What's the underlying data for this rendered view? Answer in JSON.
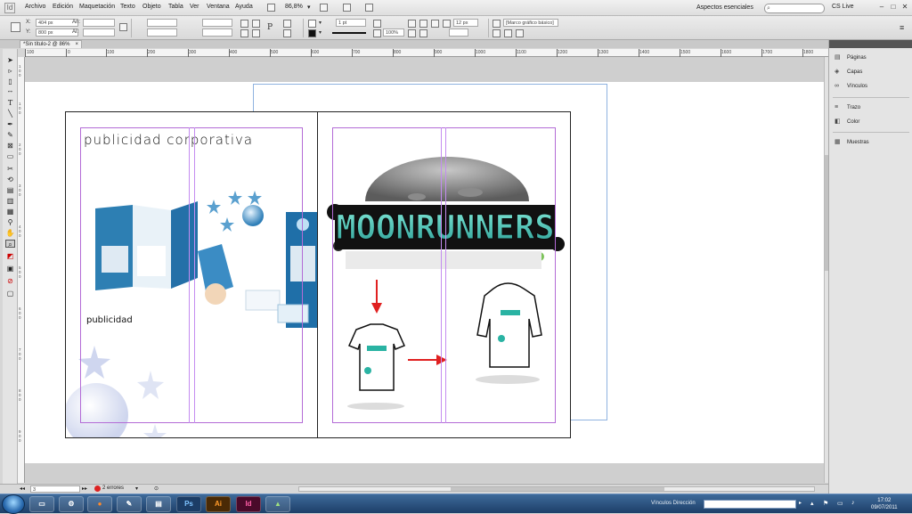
{
  "menubar": {
    "items": [
      "Archivo",
      "Edición",
      "Maquetación",
      "Texto",
      "Objeto",
      "Tabla",
      "Ver",
      "Ventana",
      "Ayuda"
    ],
    "zoom": "86,8%",
    "workspace": "Aspectos esenciales",
    "cs_live": "CS Live",
    "window_controls": [
      "–",
      "□",
      "✕"
    ]
  },
  "controlbar": {
    "x_label": "X:",
    "x_value": "404 px",
    "y_label": "Y:",
    "y_value": "800 px",
    "w_label": "An:",
    "h_label": "Al:",
    "stroke_weight": "1 pt",
    "opacity": "100%",
    "size_value": "12 px",
    "frame_style": "[Marco gráfico básico]"
  },
  "document": {
    "tab_title": "*Sin título-2 @ 86%"
  },
  "ruler": {
    "labels": [
      "100",
      "0",
      "100",
      "200",
      "300",
      "400",
      "500",
      "600",
      "700",
      "800",
      "900",
      "1000",
      "1100",
      "1200",
      "1300",
      "1400",
      "1500",
      "1600",
      "1700",
      "1800"
    ],
    "left_labels": [
      "1",
      "0",
      "0",
      "1",
      "0",
      "0",
      "2",
      "0",
      "0",
      "3",
      "0",
      "0",
      "4",
      "0",
      "0",
      "5",
      "0",
      "0",
      "6",
      "0",
      "0",
      "7",
      "0",
      "0",
      "8",
      "0",
      "0",
      "9",
      "0",
      "0"
    ]
  },
  "page_left": {
    "title": "publicidad corporativa",
    "subtitle": "publicidad"
  },
  "page_right": {
    "logo_text": "MOONRUNNERS"
  },
  "panels": {
    "items": [
      {
        "label": "Páginas",
        "icon": "pages-icon"
      },
      {
        "label": "Capas",
        "icon": "layers-icon"
      },
      {
        "label": "Vínculos",
        "icon": "links-icon"
      },
      {
        "label": "Trazo",
        "icon": "stroke-icon"
      },
      {
        "label": "Color",
        "icon": "color-icon"
      },
      {
        "label": "Muestras",
        "icon": "swatches-icon"
      }
    ]
  },
  "statusbar": {
    "page_value": "3",
    "errors": "2 errores"
  },
  "taskbar": {
    "apps": [
      "Ps",
      "Ai",
      "Id"
    ],
    "address_label": "Vínculos   Dirección",
    "clock_time": "17:02",
    "clock_date": "09/07/2011"
  },
  "colors": {
    "accent_purple": "#b36bd6",
    "logo_teal": "#2ab3a3",
    "arrow_red": "#e02020"
  }
}
